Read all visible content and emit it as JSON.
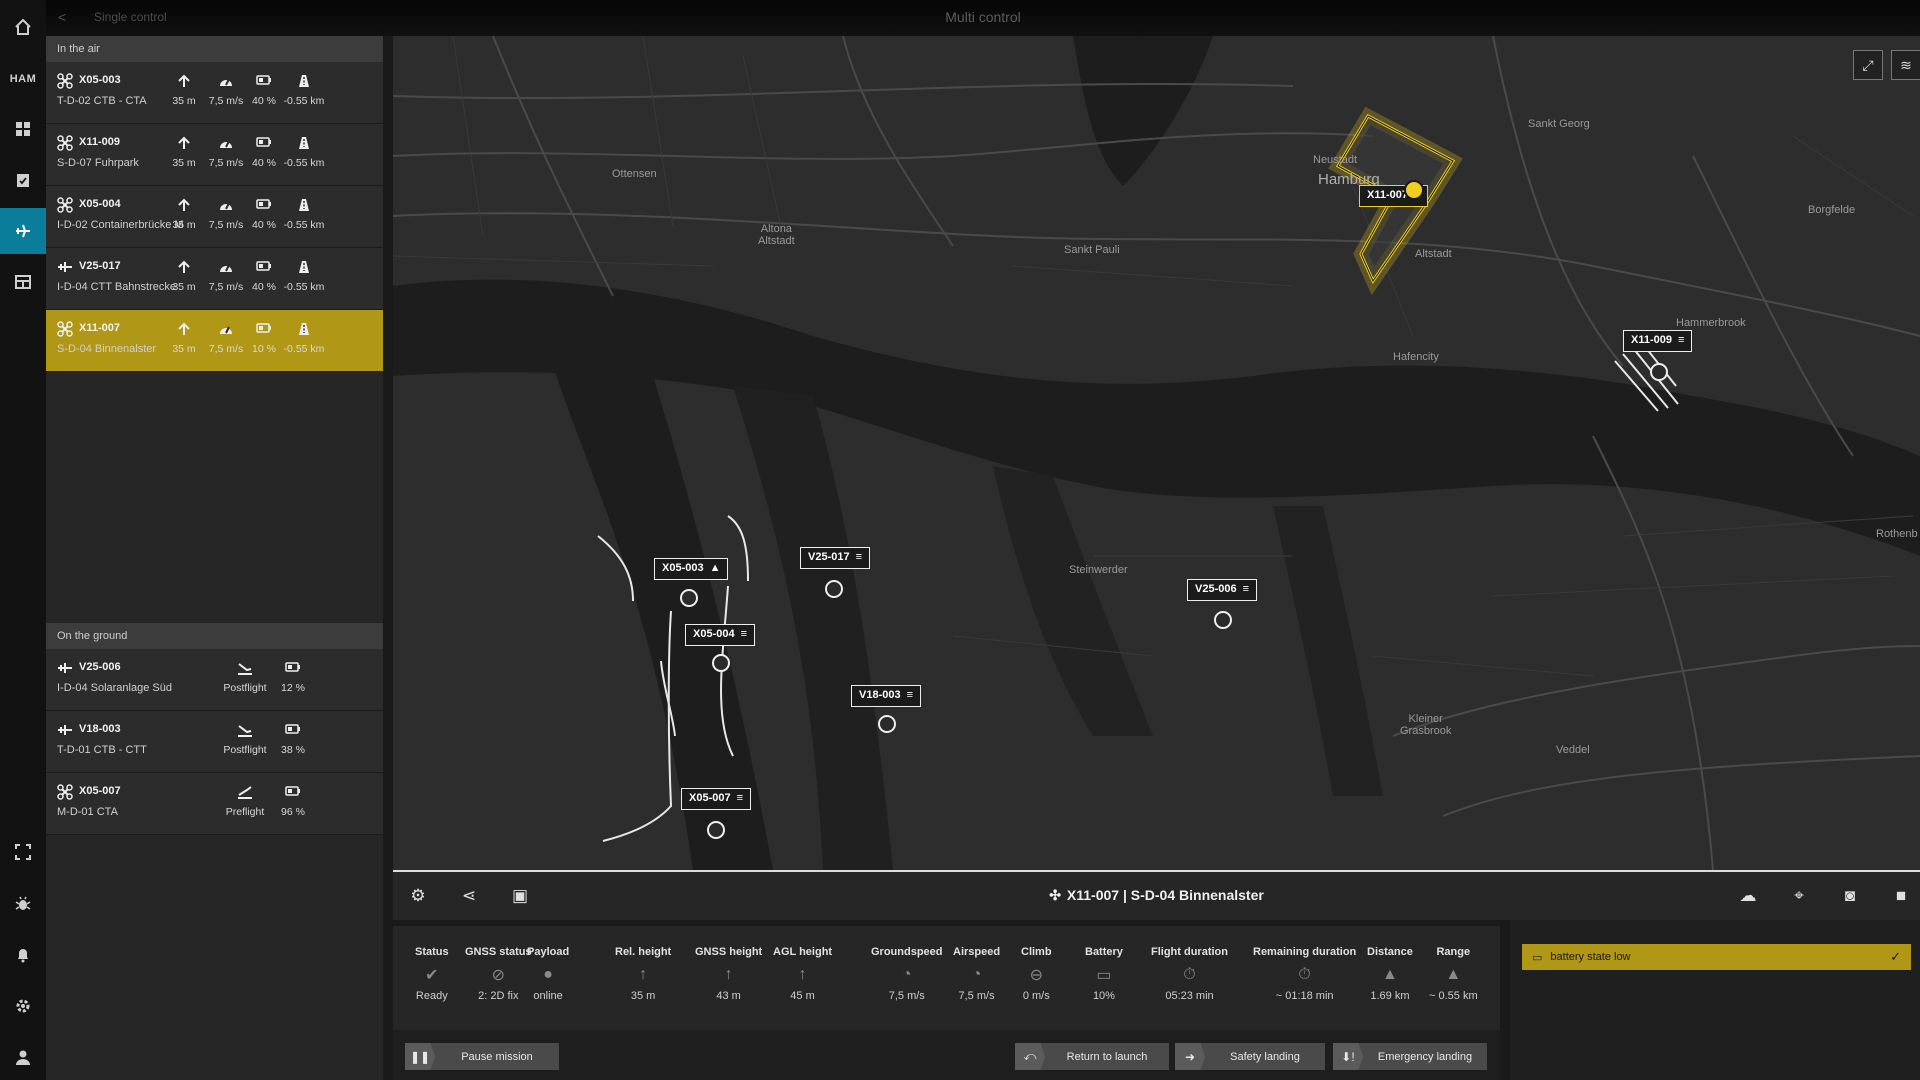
{
  "rail": {
    "station": "HAM"
  },
  "topbar": {
    "breadcrumb": "Single control",
    "title": "Multi control"
  },
  "sidebar": {
    "in_air_header": "In the air",
    "in_air": [
      {
        "id": "X05-003",
        "mission": "T-D-02 CTB - CTA",
        "type": "drone",
        "height": "35 m",
        "speed": "7,5 m/s",
        "battery": "40 %",
        "range": "-0.55 km"
      },
      {
        "id": "X11-009",
        "mission": "S-D-07 Fuhrpark",
        "type": "drone",
        "height": "35 m",
        "speed": "7,5 m/s",
        "battery": "40 %",
        "range": "-0.55 km"
      },
      {
        "id": "X05-004",
        "mission": "I-D-02 Containerbrücke M",
        "type": "drone",
        "height": "35 m",
        "speed": "7,5 m/s",
        "battery": "40 %",
        "range": "-0.55 km"
      },
      {
        "id": "V25-017",
        "mission": "I-D-04 CTT Bahnstrecke",
        "type": "plane",
        "height": "35 m",
        "speed": "7,5 m/s",
        "battery": "40 %",
        "range": "-0.55 km"
      },
      {
        "id": "X11-007",
        "mission": "S-D-04 Binnenalster",
        "type": "drone",
        "height": "35 m",
        "speed": "7,5 m/s",
        "battery": "10 %",
        "range": "-0.55 km",
        "selected": true
      }
    ],
    "on_ground_header": "On the ground",
    "on_ground": [
      {
        "id": "V25-006",
        "mission": "I-D-04 Solaranlage Süd",
        "type": "plane",
        "phase": "Postflight",
        "battery": "12 %"
      },
      {
        "id": "V18-003",
        "mission": "T-D-01 CTB - CTT",
        "type": "plane",
        "phase": "Postflight",
        "battery": "38 %"
      },
      {
        "id": "X05-007",
        "mission": "M-D-01 CTA",
        "type": "drone",
        "phase": "Preflight",
        "battery": "96 %"
      }
    ]
  },
  "map": {
    "labels": {
      "ottensen": "Ottensen",
      "altona": "Altona\nAltstadt",
      "sankt_pauli": "Sankt Pauli",
      "neustadt": "Neustadt",
      "hamburg": "Hamburg",
      "altstadt": "Altstadt",
      "sankt_georg": "Sankt Georg",
      "borgfelde": "Borgfelde",
      "hammerbrook": "Hammerbrook",
      "hafencity": "Hafencity",
      "rothenburg": "Rothenb",
      "steinwerder": "Steinwerder",
      "kleiner_grasbrook": "Kleiner\nGrasbrook",
      "veddel": "Veddel"
    },
    "tags": {
      "x11_007": "X11-007",
      "x11_009": "X11-009",
      "x05_003": "X05-003",
      "v25_017": "V25-017",
      "x05_004": "X05-004",
      "v18_003": "V18-003",
      "v25_006": "V25-006",
      "x05_007": "X05-007"
    },
    "accent": "#f2cf1e"
  },
  "panel": {
    "title": "X11-007 | S-D-04 Binnenalster",
    "stats": [
      {
        "label": "Status",
        "value": "Ready",
        "icon": "check-circle-icon"
      },
      {
        "label": "GNSS status",
        "value": "2: 2D fix",
        "icon": "satellite-icon"
      },
      {
        "label": "Payload",
        "value": "online",
        "icon": "dot-icon"
      },
      {
        "label": "Rel. height",
        "value": "35 m",
        "icon": "arrow-up-icon"
      },
      {
        "label": "GNSS height",
        "value": "43 m",
        "icon": "arrow-up-icon"
      },
      {
        "label": "AGL height",
        "value": "45 m",
        "icon": "arrow-up-icon"
      },
      {
        "label": "Groundspeed",
        "value": "7,5 m/s",
        "icon": "speedometer-icon"
      },
      {
        "label": "Airspeed",
        "value": "7,5 m/s",
        "icon": "speedometer-icon"
      },
      {
        "label": "Climb",
        "value": "0 m/s",
        "icon": "climb-icon"
      },
      {
        "label": "Battery",
        "value": "10%",
        "icon": "battery-icon"
      },
      {
        "label": "Flight duration",
        "value": "05:23 min",
        "icon": "stopwatch-icon"
      },
      {
        "label": "Remaining duration",
        "value": "~ 01:18 min",
        "icon": "stopwatch-icon"
      },
      {
        "label": "Distance",
        "value": "1.69 km",
        "icon": "road-icon"
      },
      {
        "label": "Range",
        "value": "~ 0.55 km",
        "icon": "road-icon"
      }
    ],
    "actions": {
      "pause": "Pause mission",
      "rtl": "Return to launch",
      "safety": "Safety landing",
      "emergency": "Emergency landing"
    },
    "alert": "battery state low"
  }
}
